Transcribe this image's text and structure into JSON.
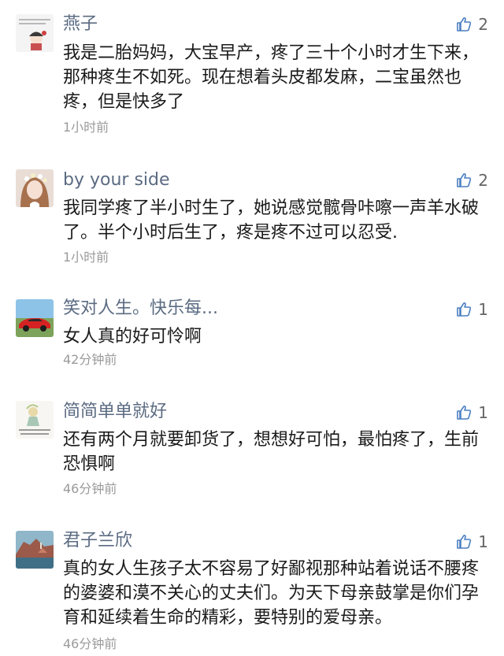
{
  "comments": [
    {
      "user": "燕子",
      "avatar_icon": "cartoon-girl-text-avatar-icon",
      "likes": "2",
      "text": "我是二胎妈妈，大宝早产，疼了三十个小时才生下来，那种疼生不如死。现在想着头皮都发麻，二宝虽然也疼，但是快多了",
      "time": "1小时前"
    },
    {
      "user": "by your side",
      "avatar_icon": "flower-crown-girl-avatar-icon",
      "likes": "2",
      "text": "我同学疼了半小时生了，她说感觉髋骨咔嚓一声羊水破了。半个小时后生了，疼是疼不过可以忍受.",
      "time": "1小时前"
    },
    {
      "user": "笑对人生。快乐每...",
      "avatar_icon": "red-sports-car-avatar-icon",
      "likes": "1",
      "text": "女人真的好可怜啊",
      "time": "42分钟前"
    },
    {
      "user": "简简单单就好",
      "avatar_icon": "illustrated-girl-text-avatar-icon",
      "likes": "1",
      "text": "还有两个月就要卸货了，想想好可怕，最怕疼了，生前恐惧啊",
      "time": "46分钟前"
    },
    {
      "user": "君子兰欣",
      "avatar_icon": "coastal-landscape-avatar-icon",
      "likes": "1",
      "text": "真的女人生孩子太不容易了好鄙视那种站着说话不腰疼的婆婆和漠不关心的丈夫们。为天下母亲鼓掌是你们孕育和延续着生命的精彩，要特别的爱母亲。",
      "time": "46分钟前"
    }
  ],
  "colors": {
    "username": "#5b6b82",
    "timestamp": "#9a9a9a",
    "like_icon": "#4a7fc1"
  }
}
